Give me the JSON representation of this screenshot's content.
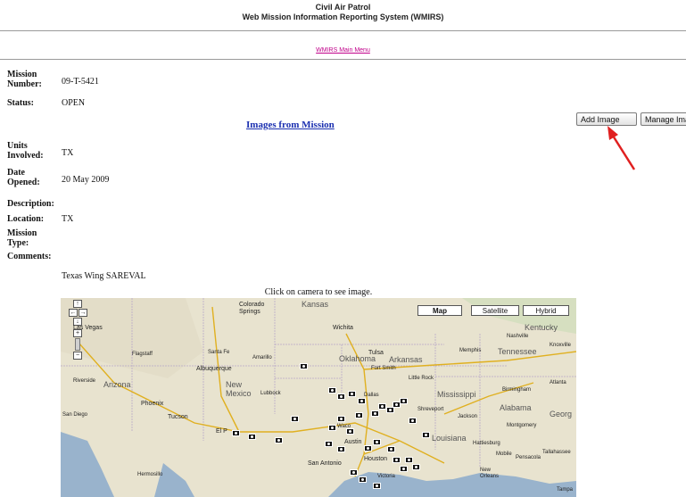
{
  "header": {
    "org": "Civil Air Patrol",
    "system": "Web Mission Information Reporting System (WMIRS)"
  },
  "nav": {
    "main_menu": "WMIRS Main Menu"
  },
  "mission": {
    "number_label": "Mission Number:",
    "number": "09-T-5421",
    "status_label": "Status:",
    "status": "OPEN",
    "images_link": "Images from Mission",
    "units_label": "Units Involved:",
    "units": "TX",
    "date_label": "Date Opened:",
    "date": "20 May 2009",
    "description_label": "Description:",
    "location_label": "Location:",
    "location": "TX",
    "type_label": "Mission Type:",
    "comments_label": "Comments:",
    "comments": "Texas Wing SAREVAL"
  },
  "buttons": {
    "add_image": "Add Image",
    "manage_images": "Manage Images"
  },
  "map": {
    "caption": "Click on camera to see image.",
    "types": [
      "Map",
      "Satellite",
      "Hybrid"
    ],
    "selected_type": "Map",
    "controls": {
      "up": "↑",
      "left": "←",
      "right": "→",
      "down": "↓",
      "zoom_in": "+",
      "zoom_out": "−"
    },
    "states": [
      "Arizona",
      "New Mexico",
      "Kansas",
      "Oklahoma",
      "Arkansas",
      "Mississippi",
      "Alabama",
      "Louisiana",
      "Kentucky",
      "Tennessee",
      "Georg"
    ],
    "cities": [
      "Las Vegas",
      "Colorado Springs",
      "Wichita",
      "Tulsa",
      "Albuquerque",
      "Amarillo",
      "Lubbock",
      "Phoenix",
      "Tucson",
      "El P",
      "Austin",
      "San Antonio",
      "Houston",
      "Riverside",
      "San Diego",
      "Memphis",
      "Jackson",
      "Atlanta",
      "New Orleans",
      "Flagstaff",
      "Santa Fe",
      "Fort Smith",
      "Little Rock",
      "Birmingham",
      "Montgomery",
      "Tallahassee",
      "Tampa",
      "Nashville",
      "Knoxville",
      "Dallas",
      "Waco",
      "Shreveport",
      "Hattiesburg",
      "Mobile",
      "Pensacola",
      "Victoria",
      "Hermosillo"
    ]
  }
}
